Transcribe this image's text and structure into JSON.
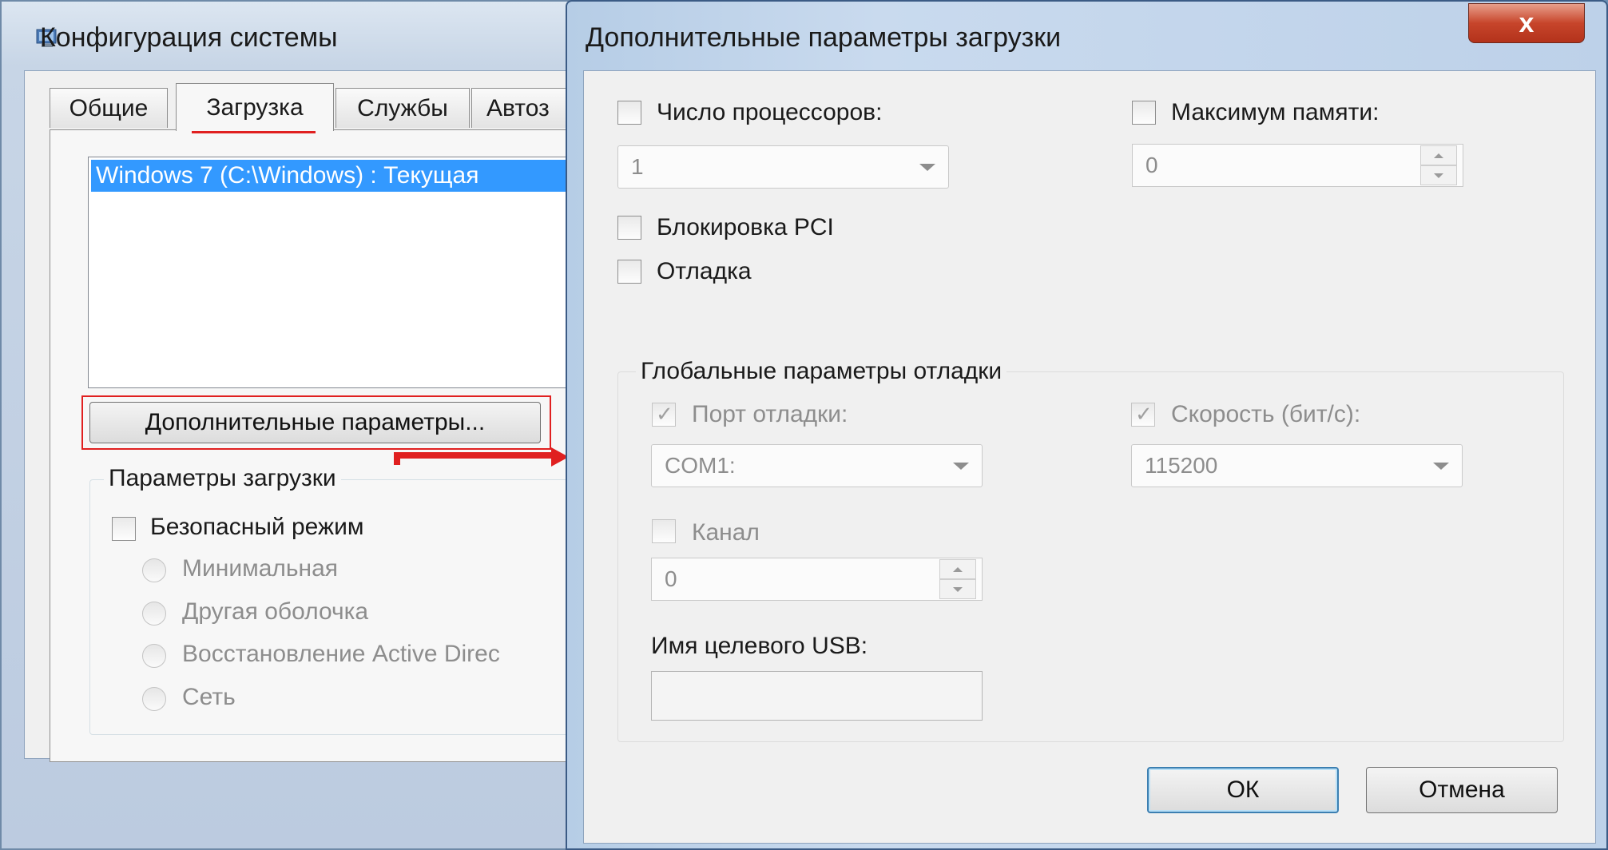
{
  "back_window": {
    "title": "Конфигурация системы",
    "tabs": [
      {
        "label": "Общие"
      },
      {
        "label": "Загрузка"
      },
      {
        "label": "Службы"
      },
      {
        "label": "Автоз"
      }
    ],
    "os_list": {
      "selected_item": "Windows 7 (C:\\Windows) : Текущая"
    },
    "advanced_button_label": "Дополнительные параметры...",
    "boot_options": {
      "legend": "Параметры загрузки",
      "safe_mode_label": "Безопасный режим",
      "radios": [
        {
          "label": "Минимальная"
        },
        {
          "label": "Другая оболочка"
        },
        {
          "label": "Восстановление Active Direc"
        },
        {
          "label": "Сеть"
        }
      ]
    }
  },
  "dialog": {
    "title": "Дополнительные параметры загрузки",
    "close_symbol": "x",
    "num_processors": {
      "label": "Число процессоров:",
      "value": "1",
      "checked": false
    },
    "max_memory": {
      "label": "Максимум памяти:",
      "value": "0",
      "checked": false
    },
    "pci_lock": {
      "label": "Блокировка PCI",
      "checked": false
    },
    "debug": {
      "label": "Отладка",
      "checked": false
    },
    "debug_settings": {
      "legend": "Глобальные параметры отладки",
      "debug_port": {
        "label": "Порт отладки:",
        "value": "COM1:",
        "checked": true
      },
      "baud_rate": {
        "label": "Скорость (бит/с):",
        "value": "115200",
        "checked": true
      },
      "channel": {
        "label": "Канал",
        "value": "0",
        "checked": false
      },
      "usb_target": {
        "label": "Имя целевого USB:",
        "value": ""
      }
    },
    "ok_label": "ОК",
    "cancel_label": "Отмена"
  },
  "colors": {
    "selection": "#3399ff",
    "annotation_red": "#e02020",
    "close_button": "#c7452b"
  }
}
